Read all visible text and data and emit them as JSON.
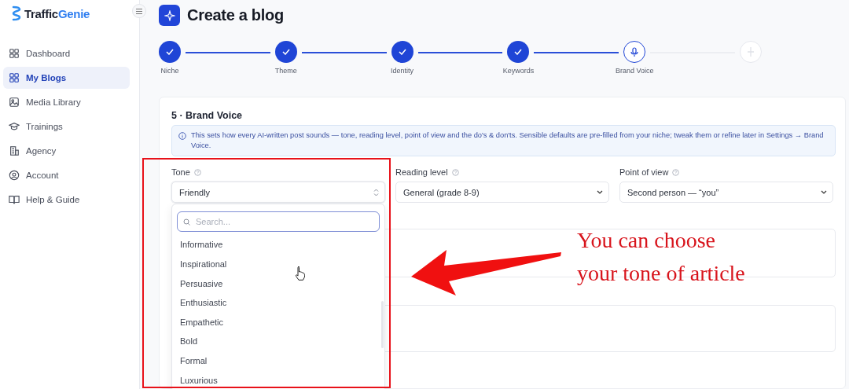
{
  "sidebar": {
    "logo": {
      "text_1": "Traffic",
      "text_2": "Genie"
    },
    "items": [
      {
        "label": "Dashboard",
        "selected": false
      },
      {
        "label": "My Blogs",
        "selected": true
      },
      {
        "label": "Media Library",
        "selected": false
      },
      {
        "label": "Trainings",
        "selected": false
      },
      {
        "label": "Agency",
        "selected": false
      },
      {
        "label": "Account",
        "selected": false
      },
      {
        "label": "Help & Guide",
        "selected": false
      }
    ]
  },
  "page": {
    "title": "Create a blog"
  },
  "steps": [
    {
      "label": "Niche",
      "completed": true,
      "selected": false
    },
    {
      "label": "Theme",
      "completed": true,
      "selected": false
    },
    {
      "label": "Identity",
      "completed": true,
      "selected": false
    },
    {
      "label": "Keywords",
      "completed": true,
      "selected": false
    },
    {
      "label": "Brand Voice",
      "completed": false,
      "selected": true
    },
    {
      "completed": false,
      "selected": false
    }
  ],
  "section": {
    "heading": "5 · Brand Voice",
    "info": "This sets how every AI-written post sounds — tone, reading level, point of view and the do's & don'ts. Sensible defaults are pre-filled from your niche; tweak them or refine later in Settings → Brand Voice.",
    "fields": [
      {
        "label": "Tone",
        "value": "Friendly",
        "kind": "combobox",
        "expanded": true
      },
      {
        "label": "Reading level",
        "value": "General (grade 8-9)",
        "kind": "select",
        "expanded": false
      },
      {
        "label": "Point of view",
        "value": "Second person — “you”",
        "kind": "select",
        "expanded": false
      }
    ],
    "dropdown": {
      "search": {
        "placeholder": "Search..."
      },
      "options": [
        "Informative",
        "Inspirational",
        "Persuasive",
        "Enthusiastic",
        "Empathetic",
        "Bold",
        "Formal",
        "Luxurious"
      ]
    }
  },
  "annotation": {
    "lines": [
      "You can choose",
      "your tone of article"
    ]
  }
}
